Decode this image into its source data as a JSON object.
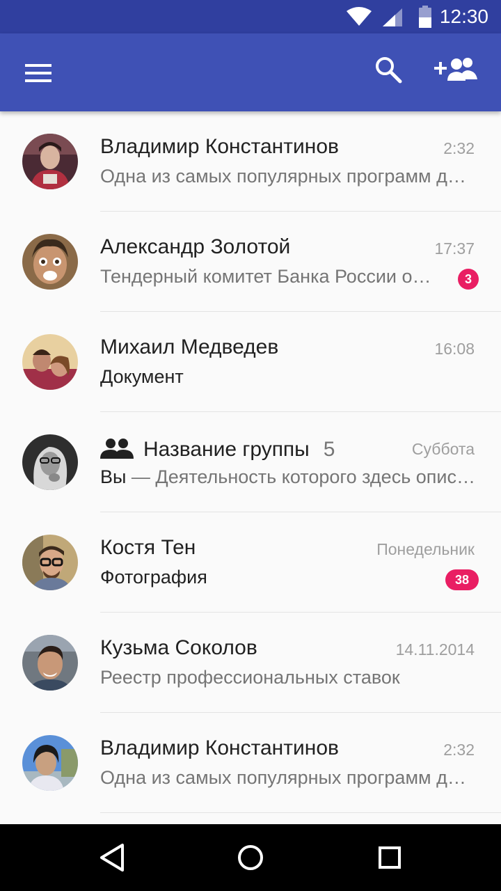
{
  "status_bar": {
    "time": "12:30",
    "icons": [
      "wifi-icon",
      "cell-signal-icon",
      "battery-icon"
    ]
  },
  "app_bar": {
    "icons": [
      "menu-icon",
      "search-icon",
      "add-contact-icon"
    ],
    "color": "#3f51b5"
  },
  "conversations": [
    {
      "name": "Владимир Константинов",
      "time": "2:32",
      "message": "Одна из самых популярных программ для мобильных",
      "avatar": "photo"
    },
    {
      "name": "Александр Золотой",
      "time": "17:37",
      "message": "Тендерный комитет Банка России объявил",
      "unread": "3",
      "avatar": "photo"
    },
    {
      "name": "Михаил Медведев",
      "time": "16:08",
      "message": "Документ",
      "avatar": "photo"
    },
    {
      "name": "Название группы",
      "member_count": "5",
      "time": "Суббота",
      "sender": "Вы",
      "message": " — Деятельность которого здесь описана",
      "is_group": true,
      "avatar": "photo"
    },
    {
      "name": "Костя Тен",
      "time": "Понедельник",
      "message": "Фотография",
      "unread": "38",
      "avatar": "photo"
    },
    {
      "name": "Кузьма Соколов",
      "time": "14.11.2014",
      "message": "Реестр профессиональных ставок",
      "avatar": "photo"
    },
    {
      "name": "Владимир Константинов",
      "time": "2:32",
      "message": "Одна из самых популярных программ для мобильных",
      "avatar": "photo"
    }
  ],
  "nav_bar": {
    "icons": [
      "back-icon",
      "home-icon",
      "recents-icon"
    ]
  },
  "colors": {
    "accent": "#e91e63",
    "status_bar": "#303f9f",
    "primary": "#3f51b5"
  }
}
